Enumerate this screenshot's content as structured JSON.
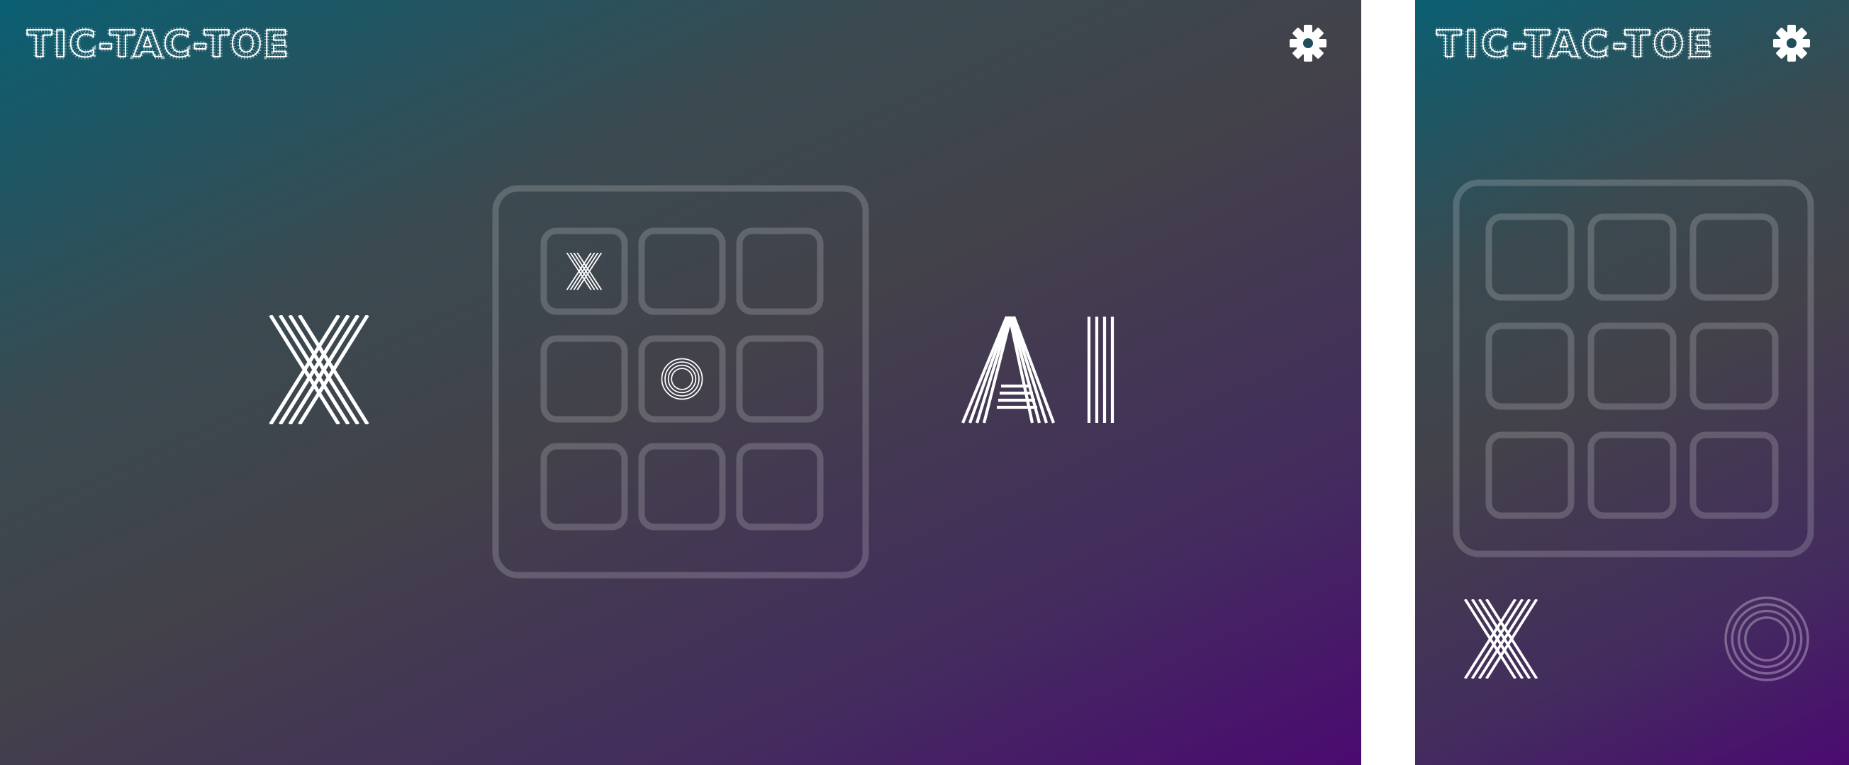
{
  "app": {
    "title": "TIC-TAC-TOE"
  },
  "colors": {
    "gradient_start": "#0a5f72",
    "gradient_end": "#4a0a70",
    "board_outline": "rgba(255,255,255,0.18)",
    "glyph": "#ffffff"
  },
  "icons": {
    "settings": "gear-icon"
  },
  "landscape": {
    "player_left": "X",
    "player_right": "AI",
    "board": [
      "X",
      "",
      "",
      "",
      "O",
      "",
      "",
      "",
      ""
    ]
  },
  "portrait": {
    "player_left": "X",
    "player_right": "O",
    "active_player": "X",
    "board": [
      "",
      "",
      "",
      "",
      "",
      "",
      "",
      "",
      ""
    ]
  }
}
